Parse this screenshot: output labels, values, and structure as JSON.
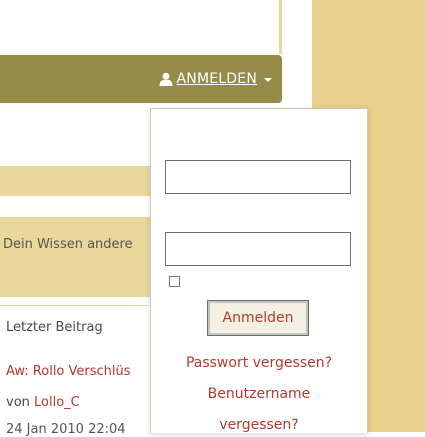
{
  "navbar": {
    "login_label": "ANMELDEN",
    "icon": "user-icon",
    "caret_icon": "caret-down-icon",
    "bg_color": "#958c4a"
  },
  "background": {
    "description_text": "Dein Wissen andere"
  },
  "login_dropdown": {
    "username_value": "",
    "password_value": "",
    "remember_checked": false,
    "submit_label": "Anmelden",
    "forgot_password_label": "Passwort vergessen?",
    "forgot_username_line1": "Benutzername",
    "forgot_username_line2": "vergessen?"
  },
  "last_post": {
    "header": "Letzter Beitrag",
    "title": "Aw: Rollo Verschlüs",
    "by_label": "von",
    "author": "Lollo_C",
    "date_partial": "24 Jan 2010 22:04"
  },
  "colors": {
    "accent_tan": "#e8d08a",
    "link_red": "#b23a2e"
  }
}
